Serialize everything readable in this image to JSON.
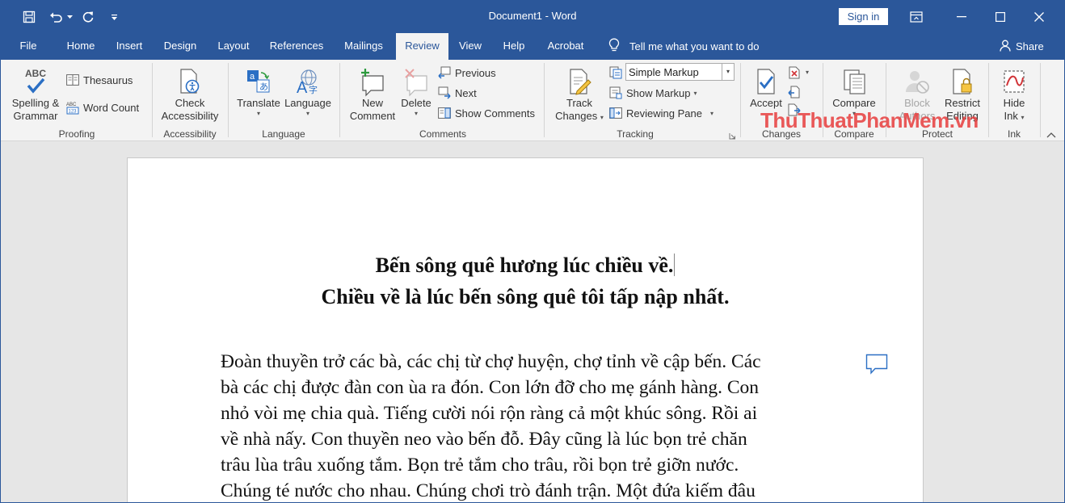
{
  "window": {
    "title": "Document1  -  Word",
    "sign_in": "Sign in"
  },
  "tabs": [
    "File",
    "Home",
    "Insert",
    "Design",
    "Layout",
    "References",
    "Mailings",
    "Review",
    "View",
    "Help",
    "Acrobat"
  ],
  "active_tab": "Review",
  "tell_me": "Tell me what you want to do",
  "share": "Share",
  "ribbon": {
    "proofing": {
      "label": "Proofing",
      "spelling": [
        "Spelling &",
        "Grammar"
      ],
      "thesaurus": "Thesaurus",
      "word_count": "Word Count"
    },
    "accessibility": {
      "label": "Accessibility",
      "check": [
        "Check",
        "Accessibility"
      ]
    },
    "language": {
      "label": "Language",
      "translate": "Translate",
      "language": "Language"
    },
    "comments": {
      "label": "Comments",
      "new_comment": [
        "New",
        "Comment"
      ],
      "delete": "Delete",
      "previous": "Previous",
      "next": "Next",
      "show_comments": "Show Comments"
    },
    "tracking": {
      "label": "Tracking",
      "track_changes": [
        "Track",
        "Changes"
      ],
      "markup_value": "Simple Markup",
      "show_markup": "Show Markup",
      "reviewing_pane": "Reviewing Pane"
    },
    "changes": {
      "label": "Changes",
      "accept": "Accept"
    },
    "compare": {
      "label": "Compare",
      "compare": "Compare"
    },
    "protect": {
      "label": "Protect",
      "block_authors": [
        "Block",
        "Authors"
      ],
      "restrict_editing": [
        "Restrict",
        "Editing"
      ]
    },
    "ink": {
      "label": "Ink",
      "hide_ink": [
        "Hide",
        "Ink"
      ]
    }
  },
  "watermark": "ThuThuatPhanMem.vn",
  "document": {
    "heading_lines": [
      "Bến sông quê hương lúc chiều về.",
      "Chiều về là lúc bến sông quê tôi tấp nập nhất."
    ],
    "body_lines": [
      "Đoàn thuyền trở các bà, các chị từ chợ huyện, chợ tỉnh về cập bến. Các",
      "bà các chị được đàn con ùa ra đón. Con lớn đỡ cho mẹ gánh hàng. Con",
      "nhỏ vòi mẹ chia quà. Tiếng cười nói rộn ràng cả một khúc sông. Rồi ai",
      "về nhà nấy. Con thuyền neo vào bến đỗ. Đây cũng là lúc bọn trẻ chăn",
      "trâu lùa trâu xuống tắm. Bọn trẻ tắm cho trâu, rồi bọn trẻ giỡn nước.",
      "Chúng té nước cho nhau. Chúng chơi trò đánh trận. Một đứa kiếm đâu"
    ]
  },
  "colors": {
    "titlebar": "#2b579a",
    "ribbon": "#f3f3f3",
    "workspace": "#e6e6e6",
    "watermark": "#e63c3c"
  }
}
